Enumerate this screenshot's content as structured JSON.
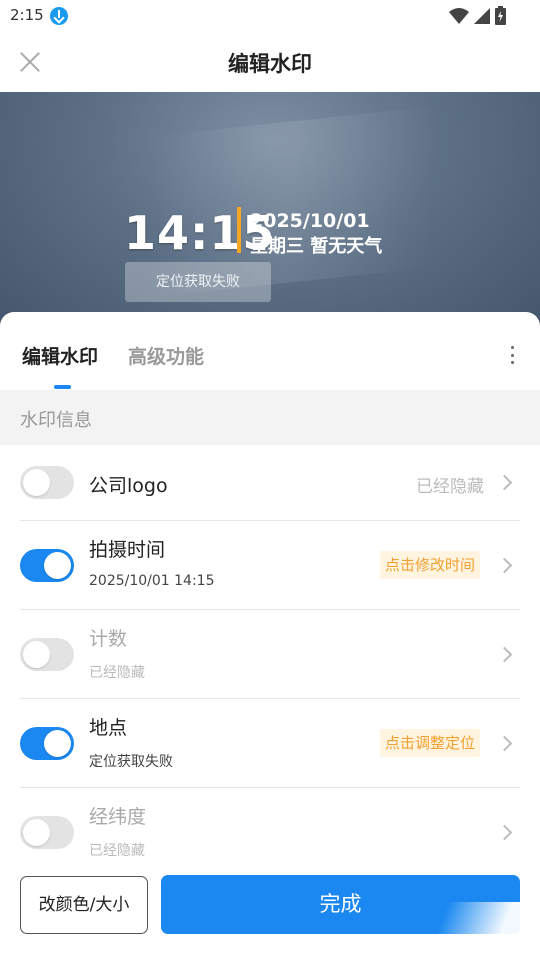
{
  "status_bar": {
    "time": "2:15"
  },
  "header": {
    "title": "编辑水印"
  },
  "watermark": {
    "time": "14:15",
    "date": "2025/10/01",
    "weekday_weather": "星期三 暂无天气",
    "location": "定位获取失败"
  },
  "tabs": {
    "edit": "编辑水印",
    "advanced": "高级功能"
  },
  "section": {
    "title": "水印信息"
  },
  "rows": [
    {
      "title": "公司logo",
      "status": "已经隐藏",
      "enabled": false
    },
    {
      "title": "拍摄时间",
      "subtitle": "2025/10/01 14:15",
      "action": "点击修改时间",
      "enabled": true
    },
    {
      "title": "计数",
      "subtitle": "已经隐藏",
      "enabled": false
    },
    {
      "title": "地点",
      "subtitle": "定位获取失败",
      "action": "点击调整定位",
      "enabled": true
    },
    {
      "title": "经纬度",
      "subtitle": "已经隐藏",
      "enabled": false
    }
  ],
  "buttons": {
    "style": "改颜色/大小",
    "done": "完成"
  },
  "colors": {
    "accent": "#1a88f0",
    "tag_bg": "#fff4e0",
    "tag_text": "#f0a030",
    "watermark_bar": "#f5a623"
  }
}
